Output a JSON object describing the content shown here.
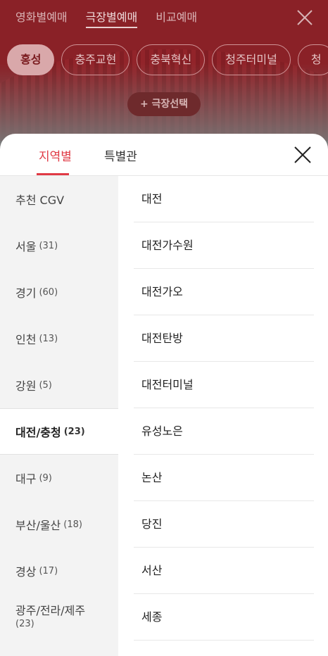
{
  "header": {
    "tabs": [
      "영화별예매",
      "극장별예매",
      "비교예매"
    ],
    "chips": [
      "홍성",
      "충주교현",
      "충북혁신",
      "청주터미널",
      "청"
    ],
    "add_theater": "+ 극장선택"
  },
  "sheet": {
    "tabs": [
      "지역별",
      "특별관"
    ],
    "regions": [
      {
        "name": "추천 CGV",
        "count": ""
      },
      {
        "name": "서울",
        "count": "(31)"
      },
      {
        "name": "경기",
        "count": "(60)"
      },
      {
        "name": "인천",
        "count": "(13)"
      },
      {
        "name": "강원",
        "count": "(5)"
      },
      {
        "name": "대전/충청",
        "count": "(23)"
      },
      {
        "name": "대구",
        "count": "(9)"
      },
      {
        "name": "부산/울산",
        "count": "(18)"
      },
      {
        "name": "경상",
        "count": "(17)"
      },
      {
        "name": "광주/전라/제주",
        "count": "(23)"
      }
    ],
    "theaters": [
      "대전",
      "대전가수원",
      "대전가오",
      "대전탄방",
      "대전터미널",
      "유성노은",
      "논산",
      "당진",
      "서산",
      "세종"
    ]
  },
  "colors": {
    "accent": "#e03a45",
    "header_bg": "#8a2127"
  }
}
